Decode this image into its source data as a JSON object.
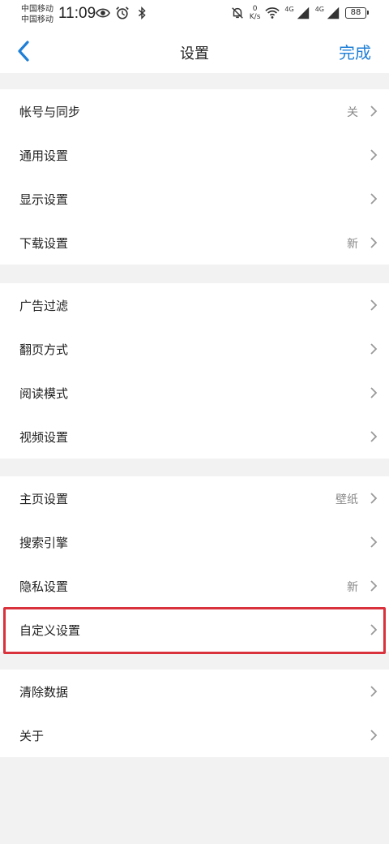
{
  "status_bar": {
    "carrier1": "中国移动",
    "carrier2": "中国移动",
    "time": "11:09",
    "net_speed_value": "0",
    "net_speed_unit": "K/s",
    "sim1_type": "4G",
    "sim2_type": "4G",
    "battery": "88"
  },
  "nav": {
    "title": "设置",
    "done_label": "完成"
  },
  "groups": [
    {
      "items": [
        {
          "label": "帐号与同步",
          "value": "关"
        },
        {
          "label": "通用设置",
          "value": ""
        },
        {
          "label": "显示设置",
          "value": ""
        },
        {
          "label": "下载设置",
          "value": "新"
        }
      ]
    },
    {
      "items": [
        {
          "label": "广告过滤",
          "value": ""
        },
        {
          "label": "翻页方式",
          "value": ""
        },
        {
          "label": "阅读模式",
          "value": ""
        },
        {
          "label": "视频设置",
          "value": ""
        }
      ]
    },
    {
      "items": [
        {
          "label": "主页设置",
          "value": "壁纸"
        },
        {
          "label": "搜索引擎",
          "value": ""
        },
        {
          "label": "隐私设置",
          "value": "新"
        },
        {
          "label": "自定义设置",
          "value": ""
        }
      ]
    },
    {
      "items": [
        {
          "label": "清除数据",
          "value": ""
        },
        {
          "label": "关于",
          "value": ""
        }
      ]
    }
  ],
  "colors": {
    "accent": "#1f7fd6",
    "highlight_border": "#d9323d",
    "background": "#f2f2f2"
  },
  "icons": [
    "eye-icon",
    "alarm-icon",
    "bluetooth-icon",
    "mute-icon",
    "wifi-icon",
    "signal-icon",
    "battery-icon",
    "back-chevron-icon",
    "chevron-right-icon"
  ]
}
